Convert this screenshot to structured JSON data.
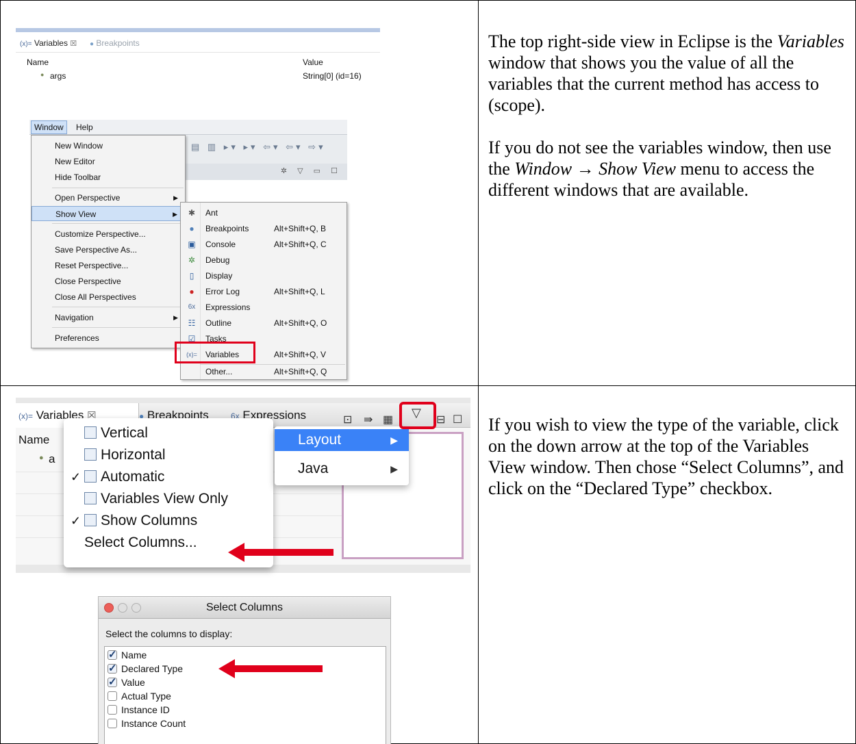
{
  "row1": {
    "text": {
      "p1_a": "The top right-side view in Eclipse is the ",
      "p1_em": "Variables",
      "p1_b": " window that shows you the value of all the variables that the current method has access to (scope).",
      "p2_a": "If you do not see the variables window, then use the ",
      "p2_em1": "Window ",
      "p2_arrow": "→",
      "p2_em2": " Show View",
      "p2_b": " menu to access the different windows that are available."
    },
    "vars_view": {
      "tabs": [
        "Variables",
        "Breakpoints"
      ],
      "tab_prefix": "(x)=",
      "close_glyph": "☒",
      "columns": [
        "Name",
        "Value"
      ],
      "row": {
        "name": "args",
        "value": "String[0]  (id=16)"
      }
    },
    "window_menu": {
      "menubar": [
        "Window",
        "Help"
      ],
      "items": [
        {
          "label": "New Window"
        },
        {
          "label": "New Editor"
        },
        {
          "label": "Hide Toolbar"
        },
        {
          "label": "Open Perspective"
        },
        {
          "label": "Show View"
        },
        {
          "label": "Customize Perspective..."
        },
        {
          "label": "Save Perspective As..."
        },
        {
          "label": "Reset Perspective..."
        },
        {
          "label": "Close Perspective"
        },
        {
          "label": "Close All Perspectives"
        },
        {
          "label": "Navigation"
        },
        {
          "label": "Preferences"
        }
      ],
      "submenu": [
        {
          "label": "Ant",
          "shortcut": "",
          "icon": "ant-icon"
        },
        {
          "label": "Breakpoints",
          "shortcut": "Alt+Shift+Q, B",
          "icon": "breakpoints-icon"
        },
        {
          "label": "Console",
          "shortcut": "Alt+Shift+Q, C",
          "icon": "console-icon"
        },
        {
          "label": "Debug",
          "shortcut": "",
          "icon": "debug-icon"
        },
        {
          "label": "Display",
          "shortcut": "",
          "icon": "display-icon"
        },
        {
          "label": "Error Log",
          "shortcut": "Alt+Shift+Q, L",
          "icon": "error-log-icon"
        },
        {
          "label": "Expressions",
          "shortcut": "",
          "icon": "expressions-icon"
        },
        {
          "label": "Outline",
          "shortcut": "Alt+Shift+Q, O",
          "icon": "outline-icon"
        },
        {
          "label": "Tasks",
          "shortcut": "",
          "icon": "tasks-icon"
        },
        {
          "label": "Variables",
          "shortcut": "Alt+Shift+Q, V",
          "icon": "variables-icon"
        },
        {
          "label": "Other...",
          "shortcut": "Alt+Shift+Q, Q",
          "icon": ""
        }
      ]
    }
  },
  "row2": {
    "text": {
      "p1": "If you wish to view the type of the variable, click on the down arrow at the top of the Variables View window.    Then chose “Select Columns”, and click on the “Declared Type” checkbox."
    },
    "layout_view": {
      "tabs": [
        "Variables",
        "Breakpoints",
        "Expressions"
      ],
      "tab_prefix": "(x)=",
      "close_glyph": "☒",
      "col_name": "Name",
      "row_name": "a",
      "popup": [
        {
          "label": "Vertical",
          "checked": false,
          "icon": true
        },
        {
          "label": "Horizontal",
          "checked": false,
          "icon": true
        },
        {
          "label": "Automatic",
          "checked": true,
          "icon": true
        },
        {
          "label": "Variables View Only",
          "checked": false,
          "icon": true
        },
        {
          "label": "Show Columns",
          "checked": true,
          "icon": true
        },
        {
          "label": "Select Columns...",
          "checked": false,
          "icon": false
        }
      ],
      "submenu": [
        {
          "label": "Layout"
        },
        {
          "label": "Java"
        }
      ],
      "check_glyph": "✓",
      "arrow_glyph": "▶",
      "dropdown_glyph": "▽",
      "minimize_glyph": "⊟",
      "maximize_glyph": "☐"
    },
    "dialog": {
      "title": "Select Columns",
      "prompt": "Select the columns to display:",
      "options": [
        {
          "label": "Name",
          "checked": true
        },
        {
          "label": "Declared Type",
          "checked": true
        },
        {
          "label": "Value",
          "checked": true
        },
        {
          "label": "Actual Type",
          "checked": false
        },
        {
          "label": "Instance ID",
          "checked": false
        },
        {
          "label": "Instance Count",
          "checked": false
        }
      ]
    }
  },
  "colors": {
    "highlight_red": "#e0001b",
    "mac_blue": "#3a82f7",
    "menu_highlight": "#cfe1f7"
  }
}
